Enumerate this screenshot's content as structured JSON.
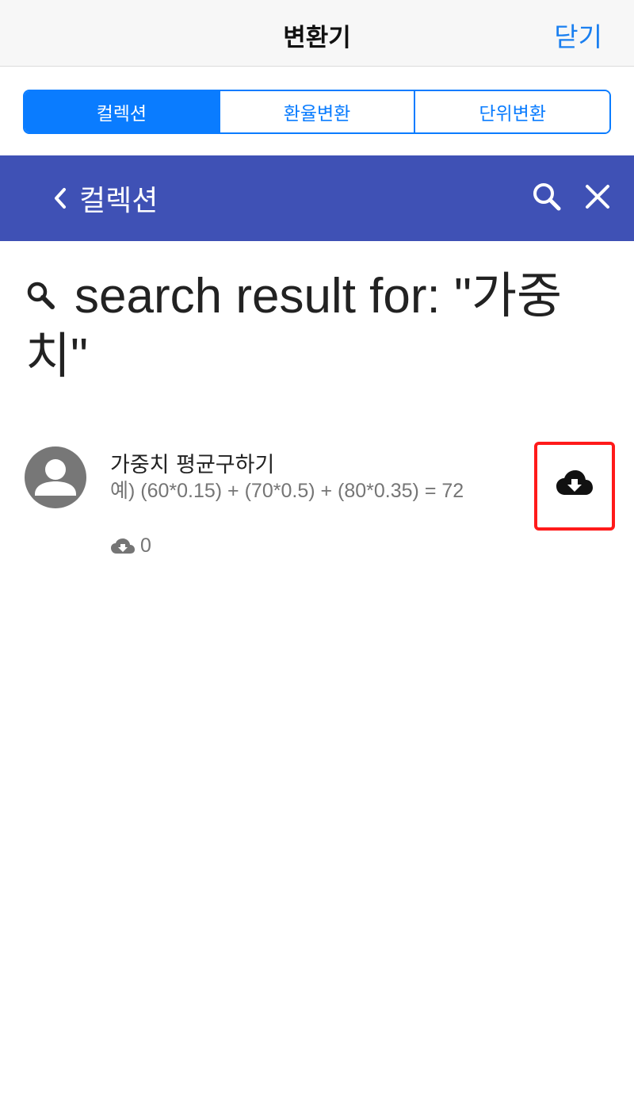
{
  "topbar": {
    "title": "변환기",
    "close_label": "닫기"
  },
  "segments": [
    {
      "label": "컬렉션",
      "active": true
    },
    {
      "label": "환율변환",
      "active": false
    },
    {
      "label": "단위변환",
      "active": false
    }
  ],
  "appbar": {
    "title": "컬렉션",
    "back_icon": "chevron-left-icon",
    "search_icon": "search-icon",
    "close_icon": "close-icon",
    "color": "#3f51b5"
  },
  "search": {
    "heading": "search result for: \"가중치\""
  },
  "results": [
    {
      "title": "가중치 평균구하기",
      "description": "예) (60*0.15) + (70*0.5) + (80*0.35) = 72",
      "downloads": "0",
      "avatar_icon": "person-avatar-icon",
      "action_icon": "cloud-download-icon"
    }
  ],
  "colors": {
    "accent": "#0a7cff",
    "appbar": "#3f51b5",
    "highlight": "#ff1a1a"
  }
}
